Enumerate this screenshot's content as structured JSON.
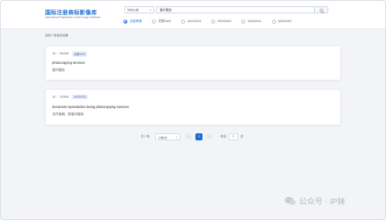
{
  "header": {
    "logo_title": "国际注册商标影像库",
    "logo_subtitle": "International Registration Goods Image Database",
    "scope_select": "所有大类",
    "search_value": "复印服务",
    "filters": [
      "全部库源",
      "尼斯2023",
      "MGS2019",
      "MGS2020",
      "MGS2021",
      "MGS2022"
    ],
    "selected_filter": "全部库源"
  },
  "results": {
    "count_text": "找到 2 条相关结果",
    "items": [
      {
        "class_no": "35",
        "code": "350089",
        "badge": "尼斯2023",
        "en": "photocopying services",
        "zh": "复印服务"
      },
      {
        "class_no": "35",
        "code": "752808",
        "badge": "MGS2022",
        "en": "document reproduction being photocopying services",
        "zh": "文件复制、即复印服务"
      }
    ]
  },
  "pagination": {
    "total": "共 2 条",
    "page_size": "10条/页",
    "current_page": "1",
    "prev": "<",
    "next": ">",
    "goto_label": "前往",
    "goto_value": "1",
    "page_unit": "页"
  },
  "watermark": {
    "text": "公众号 · IP妹",
    "icon": "wechat-icon"
  },
  "colors": {
    "accent": "#1f6fd1",
    "badge_bg": "#e8eef8"
  }
}
